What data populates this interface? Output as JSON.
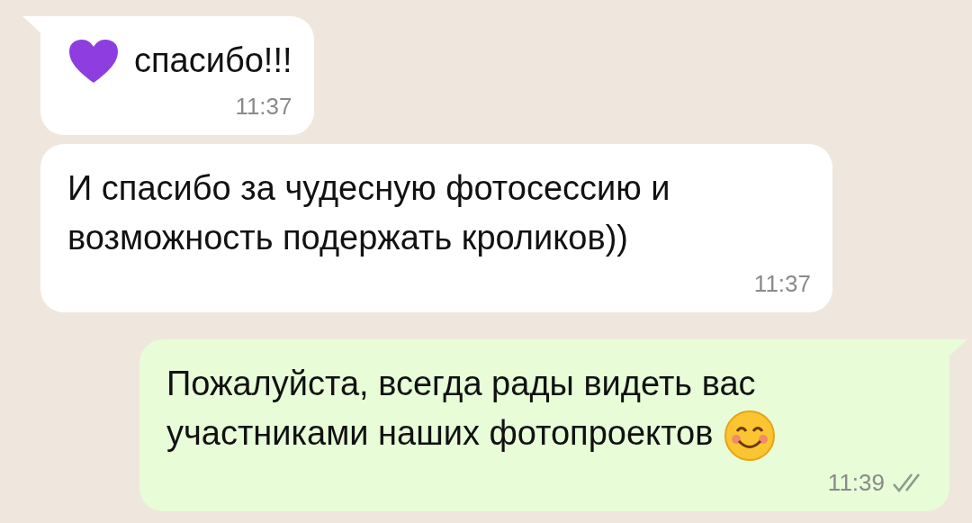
{
  "messages": [
    {
      "kind": "incoming",
      "emoji": true,
      "text": "спасибо!!!",
      "time": "11:37",
      "tail": true
    },
    {
      "kind": "incoming",
      "emoji": false,
      "text": "И спасибо за чудесную фотосессию и возможность подержать кроликов))",
      "time": "11:37",
      "tail": false
    },
    {
      "kind": "outgoing",
      "emoji": true,
      "text": "Пожалуйста, всегда рады видеть вас участниками наших фотопроектов",
      "time": "11:39",
      "read": false,
      "tail": true
    }
  ]
}
